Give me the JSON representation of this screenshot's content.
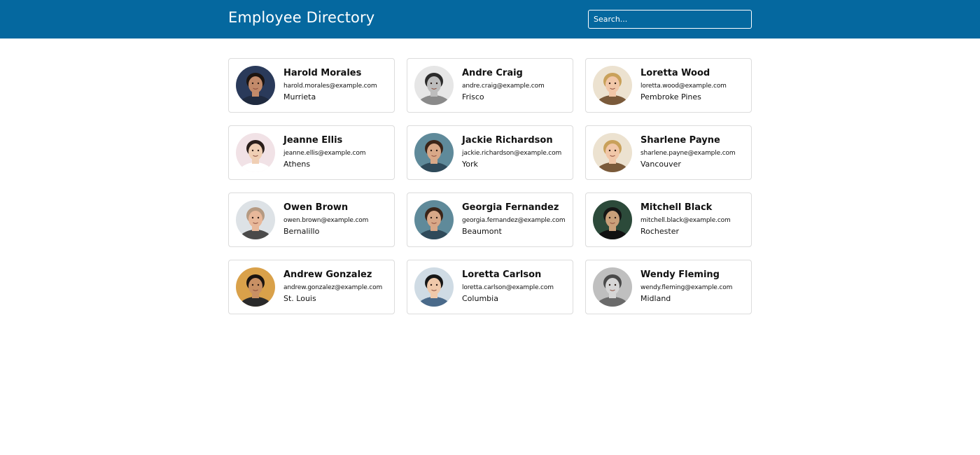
{
  "header": {
    "title": "Employee Directory",
    "search_placeholder": "Search...",
    "background_color": "#05689f"
  },
  "employees": [
    {
      "name": "Harold Morales",
      "email": "harold.morales@example.com",
      "city": "Murrieta",
      "avatar": {
        "bg": "#2a3a5a",
        "hair": "#1c1410",
        "skin": "#c28a6a",
        "shirt": "#1f2a3f"
      }
    },
    {
      "name": "Andre Craig",
      "email": "andre.craig@example.com",
      "city": "Frisco",
      "avatar": {
        "bg": "#e6e6e6",
        "hair": "#2b2b2b",
        "skin": "#bdbdbd",
        "shirt": "#8a8a8a"
      }
    },
    {
      "name": "Loretta Wood",
      "email": "loretta.wood@example.com",
      "city": "Pembroke Pines",
      "avatar": {
        "bg": "#ece2d0",
        "hair": "#c9a15a",
        "skin": "#f1c7a8",
        "shirt": "#7a5a3a"
      }
    },
    {
      "name": "Jeanne Ellis",
      "email": "jeanne.ellis@example.com",
      "city": "Athens",
      "avatar": {
        "bg": "#f1e2e6",
        "hair": "#2a1e1a",
        "skin": "#f0cfb4",
        "shirt": "#ffffff"
      }
    },
    {
      "name": "Jackie Richardson",
      "email": "jackie.richardson@example.com",
      "city": "York",
      "avatar": {
        "bg": "#5f8a9a",
        "hair": "#3a2418",
        "skin": "#d8a888",
        "shirt": "#2f4a5a"
      }
    },
    {
      "name": "Sharlene Payne",
      "email": "sharlene.payne@example.com",
      "city": "Vancouver",
      "avatar": {
        "bg": "#ece2d0",
        "hair": "#c9a15a",
        "skin": "#f1c7a8",
        "shirt": "#7a5a3a"
      }
    },
    {
      "name": "Owen Brown",
      "email": "owen.brown@example.com",
      "city": "Bernalillo",
      "avatar": {
        "bg": "#dde2e6",
        "hair": "#b59a82",
        "skin": "#e8b89a",
        "shirt": "#4a4a4a"
      }
    },
    {
      "name": "Georgia Fernandez",
      "email": "georgia.fernandez@example.com",
      "city": "Beaumont",
      "avatar": {
        "bg": "#5f8a9a",
        "hair": "#3a2418",
        "skin": "#d8a888",
        "shirt": "#2f4a5a"
      }
    },
    {
      "name": "Mitchell Black",
      "email": "mitchell.black@example.com",
      "city": "Rochester",
      "avatar": {
        "bg": "#2c4a3a",
        "hair": "#151515",
        "skin": "#c9a07a",
        "shirt": "#111111"
      }
    },
    {
      "name": "Andrew Gonzalez",
      "email": "andrew.gonzalez@example.com",
      "city": "St. Louis",
      "avatar": {
        "bg": "#d9a14a",
        "hair": "#1a1410",
        "skin": "#c89064",
        "shirt": "#2a2a2a"
      }
    },
    {
      "name": "Loretta Carlson",
      "email": "loretta.carlson@example.com",
      "city": "Columbia",
      "avatar": {
        "bg": "#cfdbe4",
        "hair": "#161616",
        "skin": "#f0c9aa",
        "shirt": "#4a6a8a"
      }
    },
    {
      "name": "Wendy Fleming",
      "email": "wendy.fleming@example.com",
      "city": "Midland",
      "avatar": {
        "bg": "#bfbfbf",
        "hair": "#4a4a4a",
        "skin": "#d6d6d6",
        "shirt": "#6a6a6a"
      }
    }
  ]
}
